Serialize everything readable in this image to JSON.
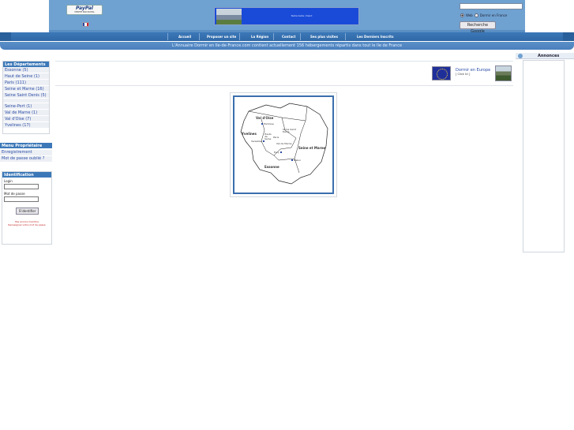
{
  "header": {
    "paypal_title": "PayPal",
    "paypal_sub": "VÉRIFIÉ PAR PAYPAL",
    "banner_text": "Texte texte chiant",
    "search_options": [
      "Web",
      "Dormir en France"
    ],
    "google_button": "Recherche Google"
  },
  "nav": [
    "Accueil",
    "Proposer un site",
    "La Région",
    "Contact",
    "Ses plus visites",
    "Les Derniers Inscrits"
  ],
  "info_bar": "L'Annuaire Dormir en Ile-de-France.com contient actuellement 156 hébergements répartis dans tout le Ile de France",
  "departements": {
    "title": "Les Départements",
    "group1": [
      "Essonne (5)",
      "Haut de Seine (1)",
      "Paris (111)",
      "Seine et Marne (16)",
      "Seine Saint Denis (5)"
    ],
    "group2": [
      "Seine-Port (1)",
      "Val de Marne (1)",
      "Val d'Oise (7)",
      "Yvelines (17)"
    ]
  },
  "menu_proprietaire": {
    "title": "Menu Propriétaire",
    "items": [
      "Enregistrement",
      "Mot de passe oublié ?"
    ]
  },
  "identification": {
    "title": "Identification",
    "login_label": "Login",
    "password_label": "Mot de passe",
    "button": "S'identifier",
    "error_line1": "Pas encore membre",
    "error_line2": "Renseignez votre mot de passe"
  },
  "annonces": {
    "title": "Annonces"
  },
  "europe": {
    "title": "Dormir en Europe",
    "sub": "[ Click Ici ]"
  },
  "map": {
    "regions": [
      "Val d'Oise",
      "Yvelines",
      "Seine et Marne",
      "Essonne",
      "Hauts de Seine",
      "Seine Saint Denis",
      "Paris",
      "Val de Marne"
    ],
    "cities": [
      "Pontoise",
      "Versailles",
      "Evry",
      "Melun"
    ]
  }
}
